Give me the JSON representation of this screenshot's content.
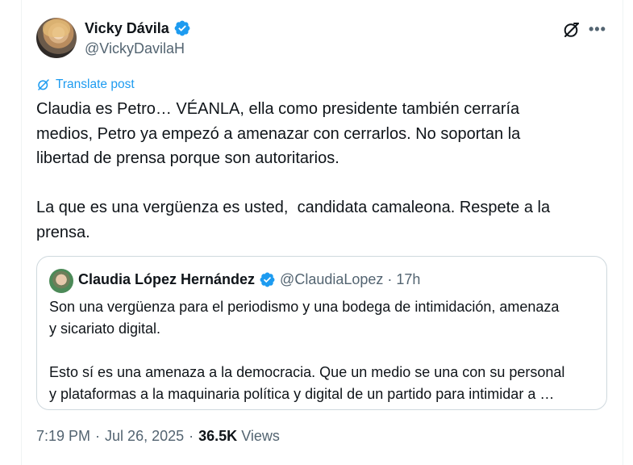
{
  "author": {
    "name": "Vicky Dávila",
    "handle": "@VickyDavilaH"
  },
  "translate_label": "Translate post",
  "tweet_text": "Claudia es Petro… VÉANLA, ella como presidente también cerraría\nmedios, Petro ya empezó a amenazar con cerrarlos. No soportan la\nlibertad de prensa porque son autoritarios.\n\nLa que es una vergüenza es usted,  candidata camaleona. Respete a la\nprensa.",
  "quoted": {
    "name": "Claudia López Hernández",
    "handle": "@ClaudiaLopez",
    "separator": "·",
    "time": "17h",
    "text": "Son una vergüenza para el periodismo y una bodega de intimidación, amenaza\ny sicariato digital.\n\nEsto sí es una amenaza a la democracia. Que un medio se una con su personal\ny plataformas a la maquinaria política y digital de un partido para intimidar a …"
  },
  "meta": {
    "time": "7:19 PM",
    "sep1": "·",
    "date": "Jul 26, 2025",
    "sep2": "·",
    "views_count": "36.5K",
    "views_label": "Views"
  },
  "icons": {
    "verified": "verified-badge-icon",
    "grok": "grok-icon",
    "more": "more-icon",
    "translate": "translate-icon"
  },
  "colors": {
    "accent": "#1d9bf0",
    "text": "#0f1419",
    "secondary": "#536471",
    "border": "#cfd9de"
  }
}
